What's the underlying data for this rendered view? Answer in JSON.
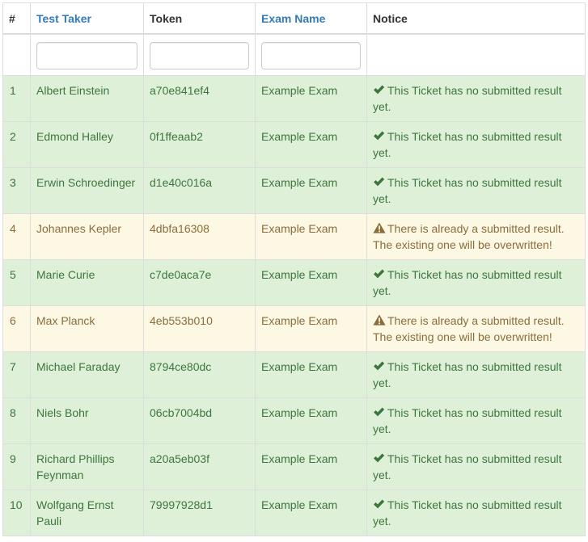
{
  "headers": {
    "num": "#",
    "test_taker": "Test Taker",
    "token": "Token",
    "exam_name": "Exam Name",
    "notice": "Notice"
  },
  "filters": {
    "test_taker": "",
    "token": "",
    "exam_name": ""
  },
  "colors": {
    "success_bg": "#dff0d8",
    "success_text": "#3c763d",
    "warning_bg": "#fcf8e3",
    "warning_text": "#8a6d3b",
    "link": "#337ab7"
  },
  "rows": [
    {
      "num": "1",
      "name": "Albert Einstein",
      "token": "a70e841ef4",
      "exam": "Example Exam",
      "status": "success",
      "icon": "check-icon",
      "notice": "This Ticket has no submitted result yet."
    },
    {
      "num": "2",
      "name": "Edmond Halley",
      "token": "0f1ffeaab2",
      "exam": "Example Exam",
      "status": "success",
      "icon": "check-icon",
      "notice": "This Ticket has no submitted result yet."
    },
    {
      "num": "3",
      "name": "Erwin Schroedinger",
      "token": "d1e40c016a",
      "exam": "Example Exam",
      "status": "success",
      "icon": "check-icon",
      "notice": "This Ticket has no submitted result yet."
    },
    {
      "num": "4",
      "name": "Johannes Kepler",
      "token": "4dbfa16308",
      "exam": "Example Exam",
      "status": "warning",
      "icon": "warning-icon",
      "notice": "There is already a submitted result. The existing one will be overwritten!"
    },
    {
      "num": "5",
      "name": "Marie Curie",
      "token": "c7de0aca7e",
      "exam": "Example Exam",
      "status": "success",
      "icon": "check-icon",
      "notice": "This Ticket has no submitted result yet."
    },
    {
      "num": "6",
      "name": "Max Planck",
      "token": "4eb553b010",
      "exam": "Example Exam",
      "status": "warning",
      "icon": "warning-icon",
      "notice": "There is already a submitted result. The existing one will be overwritten!"
    },
    {
      "num": "7",
      "name": "Michael Faraday",
      "token": "8794ce80dc",
      "exam": "Example Exam",
      "status": "success",
      "icon": "check-icon",
      "notice": "This Ticket has no submitted result yet."
    },
    {
      "num": "8",
      "name": "Niels Bohr",
      "token": "06cb7004bd",
      "exam": "Example Exam",
      "status": "success",
      "icon": "check-icon",
      "notice": "This Ticket has no submitted result yet."
    },
    {
      "num": "9",
      "name": "Richard Phillips Feynman",
      "token": "a20a5eb03f",
      "exam": "Example Exam",
      "status": "success",
      "icon": "check-icon",
      "notice": "This Ticket has no submitted result yet."
    },
    {
      "num": "10",
      "name": "Wolfgang Ernst Pauli",
      "token": "79997928d1",
      "exam": "Example Exam",
      "status": "success",
      "icon": "check-icon",
      "notice": "This Ticket has no submitted result yet."
    }
  ]
}
